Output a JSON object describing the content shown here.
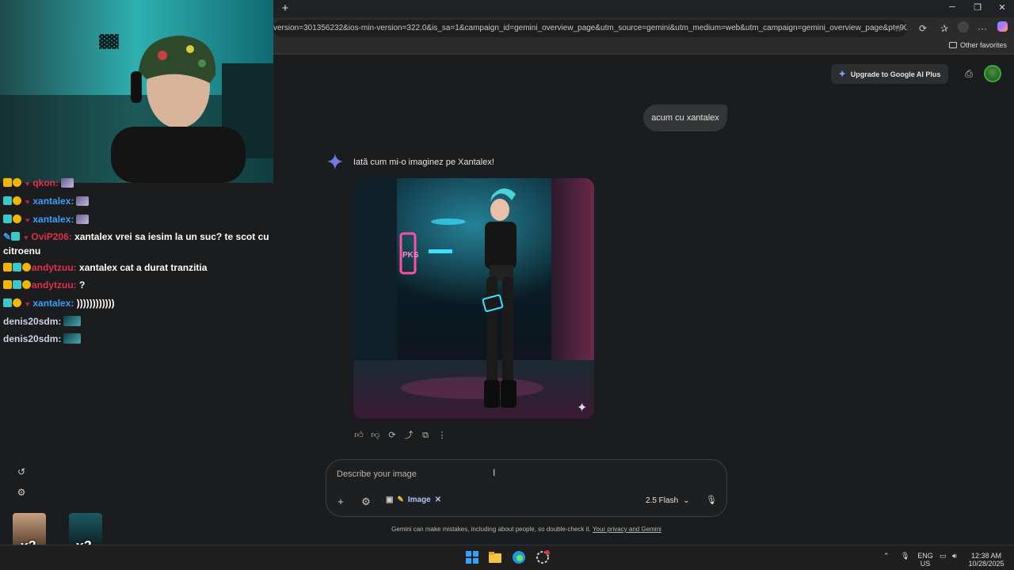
{
  "browser": {
    "url": "version=301356232&ios-min-version=322.0&is_sa=1&campaign_id=gemini_overview_page&utm_source=gemini&utm_medium=web&utm_campaign=gemini_overview_page&pt=9008&...",
    "other_favorites": "Other favorites"
  },
  "header": {
    "upgrade_label": "Upgrade to Google AI Plus"
  },
  "conversation": {
    "user_message": "acum cu xantalex",
    "response_text": "Iată cum mi-o imaginez pe Xantalex!",
    "image_sign_text": "PKS"
  },
  "input": {
    "placeholder": "Describe your image",
    "tool_chip": "Image",
    "model": "2.5 Flash"
  },
  "disclaimer": {
    "text": "Gemini can make mistakes, including about people, so double-check it.",
    "link": "Your privacy and Gemini"
  },
  "chat": {
    "messages": [
      {
        "user": "qkon:",
        "text": "",
        "color": "red"
      },
      {
        "user": "xantalex:",
        "text": "",
        "color": "blue"
      },
      {
        "user": "xantalex:",
        "text": "",
        "color": "blue"
      },
      {
        "user": "OviP206:",
        "text": "xantalex vrei sa iesim la un suc? te scot cu",
        "text2": "citroenu",
        "color": "red"
      },
      {
        "user": "andytzuu:",
        "text": "xantalex cat a durat tranzitia",
        "color": "red"
      },
      {
        "user": "andytzuu:",
        "text": "?",
        "color": "red"
      },
      {
        "user": "xantalex:",
        "text": "))))))))))))",
        "color": "blue"
      },
      {
        "user": "denis20sdm:",
        "text": "",
        "color": "grey"
      },
      {
        "user": "denis20sdm:",
        "text": "",
        "color": "grey"
      }
    ],
    "multipliers": [
      "x3",
      "x2"
    ]
  },
  "taskbar": {
    "lang": "ENG",
    "region": "US",
    "time": "12:38 AM",
    "date": "10/28/2025"
  },
  "colors": {
    "page_bg": "#1b1c1d",
    "bubble_bg": "#333537",
    "accent": "#a8c7fa",
    "gemini_blue": "#4285f4"
  }
}
